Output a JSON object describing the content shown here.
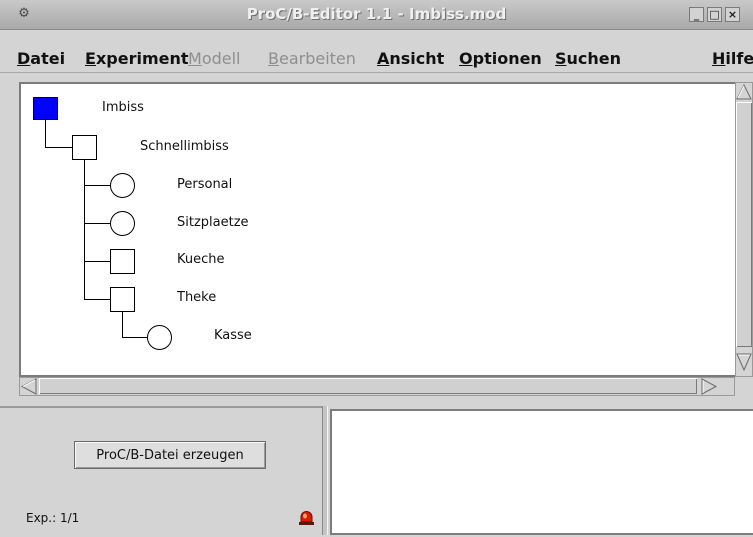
{
  "window": {
    "title": "ProC/B-Editor 1.1 - Imbiss.mod",
    "controls": {
      "minimize": "_",
      "maximize": "□",
      "close": "×"
    }
  },
  "menubar": {
    "items": [
      {
        "label": "Datei",
        "enabled": true
      },
      {
        "label": "Experiment",
        "enabled": true
      },
      {
        "label": "Modell",
        "enabled": false
      },
      {
        "label": "Bearbeiten",
        "enabled": false
      },
      {
        "label": "Ansicht",
        "enabled": true
      },
      {
        "label": "Optionen",
        "enabled": true
      },
      {
        "label": "Suchen",
        "enabled": true
      },
      {
        "label": "Hilfe",
        "enabled": true
      }
    ]
  },
  "tree": {
    "nodes": [
      {
        "label": "Imbiss",
        "shape": "square",
        "selected": true
      },
      {
        "label": "Schnellimbiss",
        "shape": "square",
        "selected": false
      },
      {
        "label": "Personal",
        "shape": "circle",
        "selected": false
      },
      {
        "label": "Sitzplaetze",
        "shape": "circle",
        "selected": false
      },
      {
        "label": "Kueche",
        "shape": "square",
        "selected": false
      },
      {
        "label": "Theke",
        "shape": "square",
        "selected": false
      },
      {
        "label": "Kasse",
        "shape": "circle",
        "selected": false
      }
    ]
  },
  "bottom": {
    "generate_button": "ProC/B-Datei erzeugen",
    "experiment_status": "Exp.: 1/1",
    "alarm_icon": "alarm-light-icon"
  },
  "colors": {
    "selected_node": "#0000ff",
    "background": "#d4d4d4"
  }
}
